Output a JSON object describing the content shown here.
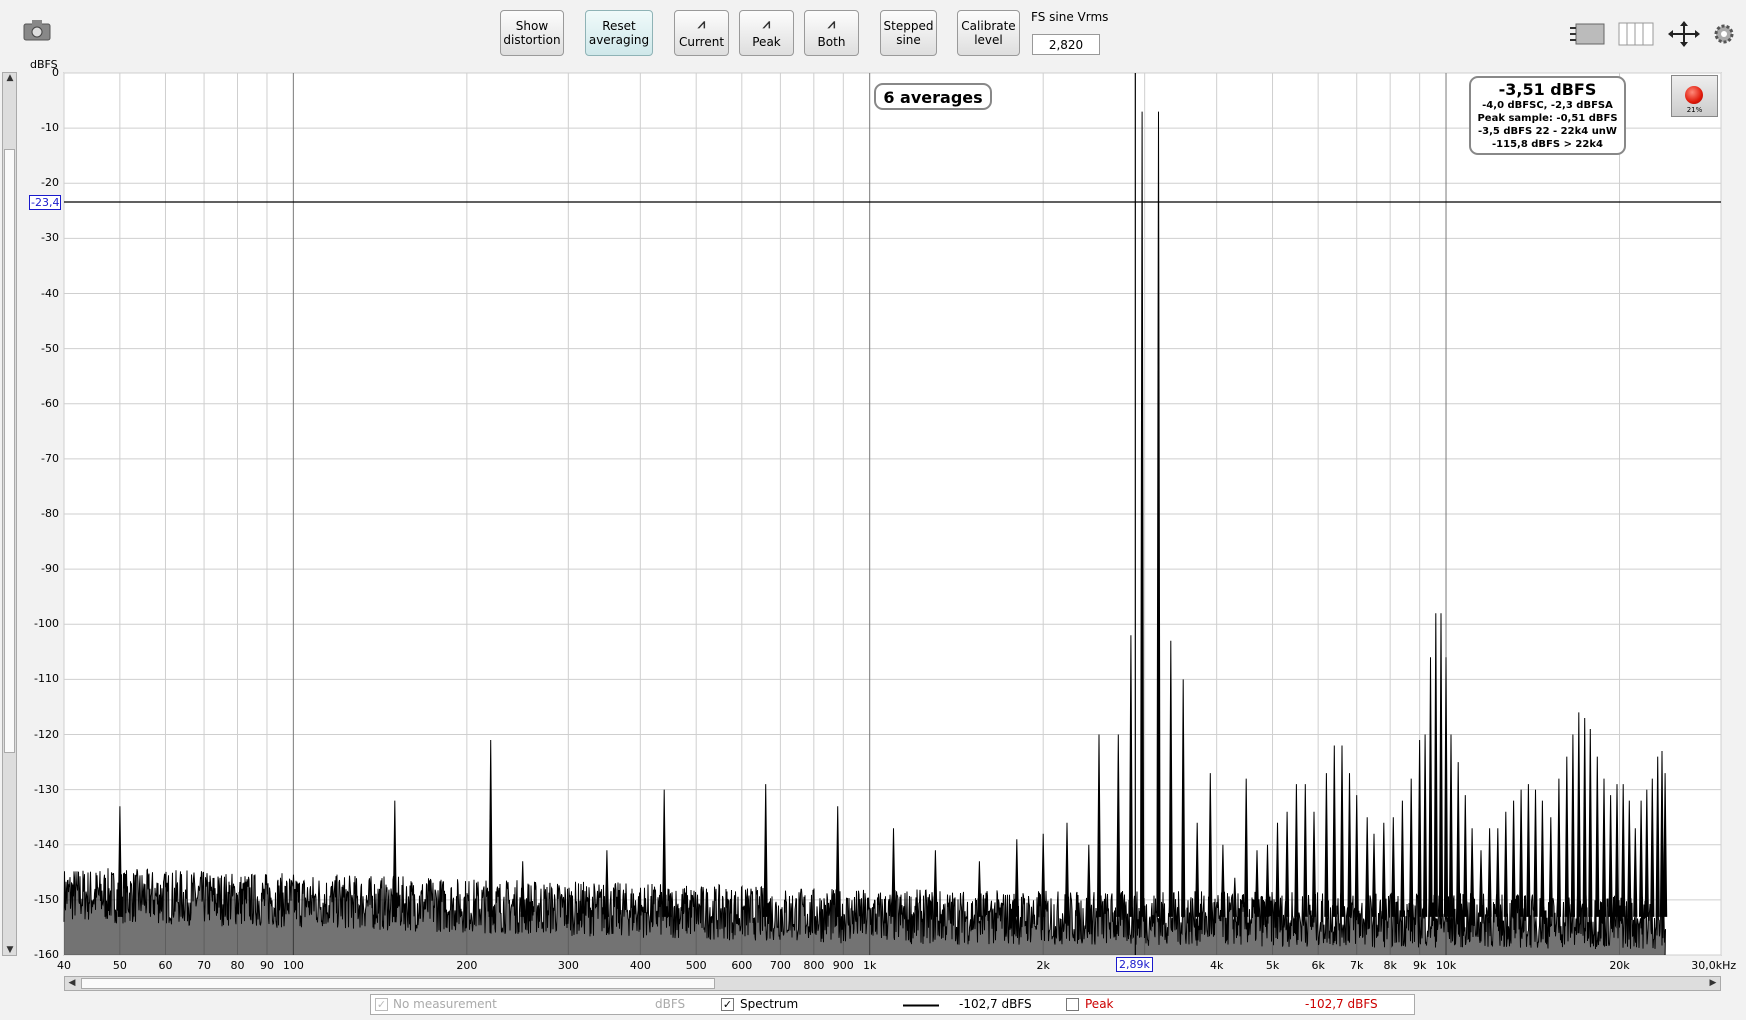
{
  "toolbar": {
    "show_distortion": "Show\ndistortion",
    "reset_averaging": "Reset\naveraging",
    "current": "Current",
    "peak": "Peak",
    "both": "Both",
    "stepped_sine": "Stepped\nsine",
    "calibrate_level": "Calibrate\nlevel",
    "fs_sine_label": "FS sine Vrms",
    "fs_sine_value": "2,820"
  },
  "averages_label": "6 averages",
  "rms_box": {
    "main": "-3,51 dBFS",
    "line1": "-4,0 dBFSC, -2,3 dBFSA",
    "line2": "Peak sample: -0,51 dBFS",
    "line3": "-3,5 dBFS 22 - 22k4 unW",
    "line4": "-115,8 dBFS > 22k4"
  },
  "record_pct": "21%",
  "cursor": {
    "y_label": "-23,4",
    "x_label": "2,89k",
    "y_value": -23.4,
    "x_value": 2890
  },
  "legend": {
    "no_measurement": "No measurement",
    "unit": "dBFS",
    "spectrum": "Spectrum",
    "spectrum_value": "-102,7 dBFS",
    "peak": "Peak",
    "peak_value": "-102,7 dBFS"
  },
  "colors": {
    "trace": "#000000",
    "peak_legend": "#cc0000",
    "cursor_label": "#1a1acc"
  },
  "chart_data": {
    "type": "line",
    "ylabel": "dBFS",
    "xunit": "Hz",
    "x_scale": "log",
    "xlim": [
      40,
      30000
    ],
    "ylim": [
      -160,
      0
    ],
    "y_ticks": [
      0,
      -10,
      -20,
      -30,
      -40,
      -50,
      -60,
      -70,
      -80,
      -90,
      -100,
      -110,
      -120,
      -130,
      -140,
      -150,
      -160
    ],
    "y_tick_labels": [
      "0",
      "-10",
      "-20",
      "-30",
      "-40",
      "-50",
      "-60",
      "-70",
      "-80",
      "-90",
      "-100",
      "-110",
      "-120",
      "-130",
      "-140",
      "-150",
      "-160"
    ],
    "x_ticks": [
      40,
      50,
      60,
      70,
      80,
      90,
      100,
      200,
      300,
      400,
      500,
      600,
      700,
      800,
      900,
      1000,
      2000,
      4000,
      5000,
      6000,
      7000,
      8000,
      9000,
      10000,
      20000,
      30000
    ],
    "x_tick_labels": [
      "40",
      "50",
      "60",
      "70",
      "80",
      "90",
      "100",
      "200",
      "300",
      "400",
      "500",
      "600",
      "700",
      "800",
      "900",
      "1k",
      "2k",
      "4k",
      "5k",
      "6k",
      "7k",
      "8k",
      "9k",
      "10k",
      "20k",
      "30,0kHz"
    ],
    "grid": true,
    "series": [
      {
        "noise_floor_db": -153,
        "noise_end_hz": 24000,
        "peaks": [
          [
            50,
            -133
          ],
          [
            150,
            -132
          ],
          [
            220,
            -121
          ],
          [
            250,
            -143
          ],
          [
            350,
            -141
          ],
          [
            440,
            -130
          ],
          [
            450,
            -150
          ],
          [
            660,
            -129
          ],
          [
            880,
            -133
          ],
          [
            1100,
            -137
          ],
          [
            1300,
            -141
          ],
          [
            1550,
            -143
          ],
          [
            1800,
            -139
          ],
          [
            2000,
            -138
          ],
          [
            2200,
            -136
          ],
          [
            2400,
            -140
          ],
          [
            2500,
            -120
          ],
          [
            2700,
            -120
          ],
          [
            2840,
            -102
          ],
          [
            2970,
            -7
          ],
          [
            3170,
            -7
          ],
          [
            3330,
            -103
          ],
          [
            3500,
            -110
          ],
          [
            3700,
            -136
          ],
          [
            3900,
            -127
          ],
          [
            4100,
            -140
          ],
          [
            4300,
            -146
          ],
          [
            4500,
            -128
          ],
          [
            4700,
            -141
          ],
          [
            4900,
            -140
          ],
          [
            5100,
            -136
          ],
          [
            5300,
            -134
          ],
          [
            5500,
            -129
          ],
          [
            5700,
            -129
          ],
          [
            5900,
            -134
          ],
          [
            6200,
            -127
          ],
          [
            6400,
            -122
          ],
          [
            6600,
            -122
          ],
          [
            6800,
            -127
          ],
          [
            7000,
            -131
          ],
          [
            7300,
            -135
          ],
          [
            7500,
            -138
          ],
          [
            7800,
            -136
          ],
          [
            8100,
            -135
          ],
          [
            8400,
            -132
          ],
          [
            8700,
            -128
          ],
          [
            9000,
            -121
          ],
          [
            9200,
            -120
          ],
          [
            9400,
            -106
          ],
          [
            9600,
            -98
          ],
          [
            9800,
            -98
          ],
          [
            10000,
            -106
          ],
          [
            10200,
            -120
          ],
          [
            10500,
            -125
          ],
          [
            10800,
            -131
          ],
          [
            11100,
            -137
          ],
          [
            11500,
            -141
          ],
          [
            11900,
            -137
          ],
          [
            12300,
            -137
          ],
          [
            12700,
            -134
          ],
          [
            13100,
            -132
          ],
          [
            13500,
            -130
          ],
          [
            13900,
            -129
          ],
          [
            14300,
            -130
          ],
          [
            14700,
            -132
          ],
          [
            15200,
            -135
          ],
          [
            15700,
            -128
          ],
          [
            16200,
            -124
          ],
          [
            16600,
            -120
          ],
          [
            17000,
            -116
          ],
          [
            17400,
            -117
          ],
          [
            17800,
            -119
          ],
          [
            18300,
            -124
          ],
          [
            18800,
            -128
          ],
          [
            19300,
            -131
          ],
          [
            19800,
            -129
          ],
          [
            20300,
            -129
          ],
          [
            20800,
            -132
          ],
          [
            21300,
            -137
          ],
          [
            21800,
            -132
          ],
          [
            22300,
            -130
          ],
          [
            22800,
            -128
          ],
          [
            23300,
            -124
          ],
          [
            23700,
            -123
          ],
          [
            24000,
            -127
          ]
        ]
      }
    ]
  }
}
